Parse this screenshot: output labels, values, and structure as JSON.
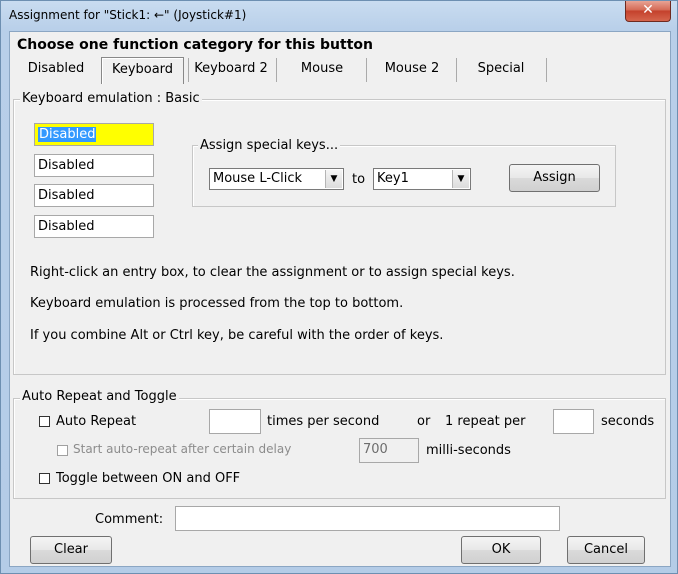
{
  "window": {
    "title": "Assignment for \"Stick1: ←\" (Joystick#1)",
    "close_label": "✕"
  },
  "heading": "Choose one function category for this button",
  "tabs": [
    {
      "label": "Disabled",
      "selected": false
    },
    {
      "label": "Keyboard",
      "selected": true
    },
    {
      "label": "Keyboard 2",
      "selected": false
    },
    {
      "label": "Mouse",
      "selected": false
    },
    {
      "label": "Mouse 2",
      "selected": false
    },
    {
      "label": "Special",
      "selected": false
    }
  ],
  "keyboard_group": {
    "title": "Keyboard emulation : Basic",
    "entries": [
      "Disabled",
      "Disabled",
      "Disabled",
      "Disabled"
    ],
    "special_keys": {
      "title": "Assign special keys...",
      "from_value": "Mouse L-Click",
      "to_label": "to",
      "to_value": "Key1",
      "assign_label": "Assign"
    },
    "help_lines": [
      "Right-click an entry box, to clear the assignment or to assign special keys.",
      "Keyboard emulation is processed from the top to bottom.",
      "If you combine Alt or Ctrl key, be careful with the order of keys."
    ]
  },
  "repeat_group": {
    "title": "Auto Repeat and Toggle",
    "auto_repeat_label": "Auto Repeat",
    "times_value": "",
    "times_label": "times per second",
    "or_label": "or",
    "repeat_per_label": "1 repeat per",
    "seconds_value": "",
    "seconds_label": "seconds",
    "delay_label": "Start auto-repeat after certain delay",
    "delay_value": "700",
    "ms_label": "milli-seconds",
    "toggle_label": "Toggle between ON and OFF"
  },
  "comment": {
    "label": "Comment:",
    "value": ""
  },
  "buttons": {
    "clear": "Clear",
    "ok": "OK",
    "cancel": "Cancel"
  },
  "colors": {
    "highlight_field": "#ffff00",
    "selection": "#3399ff"
  }
}
